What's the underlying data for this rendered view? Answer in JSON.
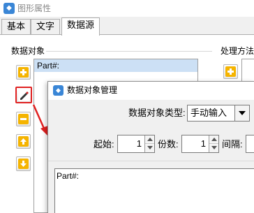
{
  "window": {
    "title": "图形属性",
    "icon": "app-icon"
  },
  "tabs": [
    {
      "label": "基本",
      "active": false
    },
    {
      "label": "文字",
      "active": false
    },
    {
      "label": "数据源",
      "active": true
    }
  ],
  "data_objects": {
    "group_label": "数据对象",
    "items": [
      {
        "label": "Part#:",
        "selected": true
      }
    ]
  },
  "processing": {
    "group_label": "处理方法"
  },
  "side_buttons": [
    {
      "name": "add-icon",
      "color": "#f0a000"
    },
    {
      "name": "edit-icon",
      "color": "#d02020",
      "highlighted": true
    },
    {
      "name": "remove-icon",
      "color": "#f0a000"
    },
    {
      "name": "move-up-icon",
      "color": "#f0a000"
    },
    {
      "name": "move-down-icon",
      "color": "#f0a000"
    }
  ],
  "dialog": {
    "title": "数据对象管理",
    "type_label": "数据对象类型:",
    "type_value": "手动输入",
    "start_label": "起始:",
    "start_value": "1",
    "copies_label": "份数:",
    "copies_value": "1",
    "interval_label": "间隔:",
    "content": "Part#:"
  },
  "colors": {
    "highlight": "#e02020",
    "selection": "#cce0f5",
    "accent_icon": "#f0a000"
  }
}
